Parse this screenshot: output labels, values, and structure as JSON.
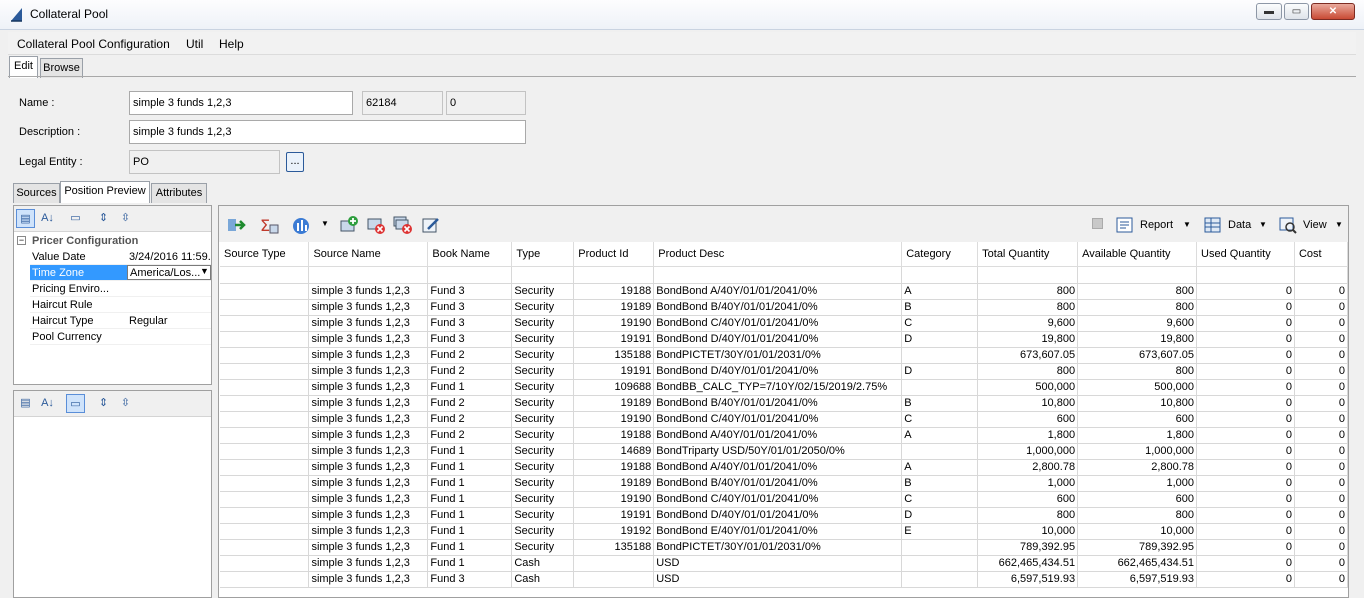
{
  "window": {
    "title": "Collateral Pool",
    "minimize": "▬",
    "maximize": "▭",
    "close": "✕"
  },
  "menu": [
    "Collateral Pool Configuration",
    "Util",
    "Help"
  ],
  "main_tabs": [
    "Edit",
    "Browse"
  ],
  "form": {
    "name_label": "Name :",
    "name_value": "simple 3 funds 1,2,3",
    "id_value": "62184",
    "version_value": "0",
    "description_label": "Description :",
    "description_value": "simple 3 funds 1,2,3",
    "legal_entity_label": "Legal Entity :",
    "legal_entity_value": "PO",
    "browse_button": "..."
  },
  "sub_tabs": [
    "Sources",
    "Position Preview",
    "Attributes"
  ],
  "property_panel": {
    "group": "Pricer Configuration",
    "rows": [
      {
        "key": "Value Date",
        "value": "3/24/2016 11:59..."
      },
      {
        "key": "Time Zone",
        "value": "America/Los..."
      },
      {
        "key": "Pricing Enviro...",
        "value": ""
      },
      {
        "key": "Haircut Rule",
        "value": ""
      },
      {
        "key": "Haircut Type",
        "value": "Regular"
      },
      {
        "key": "Pool Currency",
        "value": ""
      }
    ]
  },
  "grid_toolbar": {
    "report": "Report",
    "data": "Data",
    "view": "View"
  },
  "icons": {
    "app": "app-logo-icon",
    "categorized": "categorized-icon",
    "sort": "sort-az-icon",
    "desc": "description-icon",
    "expand": "expand-all-icon",
    "collapse": "collapse-all-icon",
    "load": "load-positions-icon",
    "sum": "sum-icon",
    "chart": "chart-icon",
    "add": "add-icon",
    "remove": "remove-icon",
    "remove_all": "remove-all-icon",
    "edit": "edit-icon",
    "stop": "stop-icon",
    "report": "report-icon",
    "data": "data-icon",
    "view": "view-icon"
  },
  "colors": {
    "selection": "#3399ff",
    "accent": "#2b5a9a",
    "close": "#c94a34"
  },
  "table": {
    "columns": [
      "Source Type",
      "Source Name",
      "Book Name",
      "Type",
      "Product Id",
      "Product Desc",
      "Category",
      "Total Quantity",
      "Available Quantity",
      "Used Quantity",
      "Cost"
    ],
    "rows": [
      [
        "",
        "simple 3 funds 1,2,3",
        "Fund 3",
        "Security",
        "19188",
        "BondBond A/40Y/01/01/2041/0%",
        "A",
        "800",
        "800",
        "0",
        "0"
      ],
      [
        "",
        "simple 3 funds 1,2,3",
        "Fund 3",
        "Security",
        "19189",
        "BondBond B/40Y/01/01/2041/0%",
        "B",
        "800",
        "800",
        "0",
        "0"
      ],
      [
        "",
        "simple 3 funds 1,2,3",
        "Fund 3",
        "Security",
        "19190",
        "BondBond C/40Y/01/01/2041/0%",
        "C",
        "9,600",
        "9,600",
        "0",
        "0"
      ],
      [
        "",
        "simple 3 funds 1,2,3",
        "Fund 3",
        "Security",
        "19191",
        "BondBond D/40Y/01/01/2041/0%",
        "D",
        "19,800",
        "19,800",
        "0",
        "0"
      ],
      [
        "",
        "simple 3 funds 1,2,3",
        "Fund 2",
        "Security",
        "135188",
        "BondPICTET/30Y/01/01/2031/0%",
        "",
        "673,607.05",
        "673,607.05",
        "0",
        "0"
      ],
      [
        "",
        "simple 3 funds 1,2,3",
        "Fund 2",
        "Security",
        "19191",
        "BondBond D/40Y/01/01/2041/0%",
        "D",
        "800",
        "800",
        "0",
        "0"
      ],
      [
        "",
        "simple 3 funds 1,2,3",
        "Fund 1",
        "Security",
        "109688",
        "BondBB_CALC_TYP=7/10Y/02/15/2019/2.75%",
        "",
        "500,000",
        "500,000",
        "0",
        "0"
      ],
      [
        "",
        "simple 3 funds 1,2,3",
        "Fund 2",
        "Security",
        "19189",
        "BondBond B/40Y/01/01/2041/0%",
        "B",
        "10,800",
        "10,800",
        "0",
        "0"
      ],
      [
        "",
        "simple 3 funds 1,2,3",
        "Fund 2",
        "Security",
        "19190",
        "BondBond C/40Y/01/01/2041/0%",
        "C",
        "600",
        "600",
        "0",
        "0"
      ],
      [
        "",
        "simple 3 funds 1,2,3",
        "Fund 2",
        "Security",
        "19188",
        "BondBond A/40Y/01/01/2041/0%",
        "A",
        "1,800",
        "1,800",
        "0",
        "0"
      ],
      [
        "",
        "simple 3 funds 1,2,3",
        "Fund 1",
        "Security",
        "14689",
        "BondTriparty USD/50Y/01/01/2050/0%",
        "",
        "1,000,000",
        "1,000,000",
        "0",
        "0"
      ],
      [
        "",
        "simple 3 funds 1,2,3",
        "Fund 1",
        "Security",
        "19188",
        "BondBond A/40Y/01/01/2041/0%",
        "A",
        "2,800.78",
        "2,800.78",
        "0",
        "0"
      ],
      [
        "",
        "simple 3 funds 1,2,3",
        "Fund 1",
        "Security",
        "19189",
        "BondBond B/40Y/01/01/2041/0%",
        "B",
        "1,000",
        "1,000",
        "0",
        "0"
      ],
      [
        "",
        "simple 3 funds 1,2,3",
        "Fund 1",
        "Security",
        "19190",
        "BondBond C/40Y/01/01/2041/0%",
        "C",
        "600",
        "600",
        "0",
        "0"
      ],
      [
        "",
        "simple 3 funds 1,2,3",
        "Fund 1",
        "Security",
        "19191",
        "BondBond D/40Y/01/01/2041/0%",
        "D",
        "800",
        "800",
        "0",
        "0"
      ],
      [
        "",
        "simple 3 funds 1,2,3",
        "Fund 1",
        "Security",
        "19192",
        "BondBond E/40Y/01/01/2041/0%",
        "E",
        "10,000",
        "10,000",
        "0",
        "0"
      ],
      [
        "",
        "simple 3 funds 1,2,3",
        "Fund 1",
        "Security",
        "135188",
        "BondPICTET/30Y/01/01/2031/0%",
        "",
        "789,392.95",
        "789,392.95",
        "0",
        "0"
      ],
      [
        "",
        "simple 3 funds 1,2,3",
        "Fund 1",
        "Cash",
        "",
        "USD",
        "",
        "662,465,434.51",
        "662,465,434.51",
        "0",
        "0"
      ],
      [
        "",
        "simple 3 funds 1,2,3",
        "Fund 3",
        "Cash",
        "",
        "USD",
        "",
        "6,597,519.93",
        "6,597,519.93",
        "0",
        "0"
      ]
    ]
  }
}
